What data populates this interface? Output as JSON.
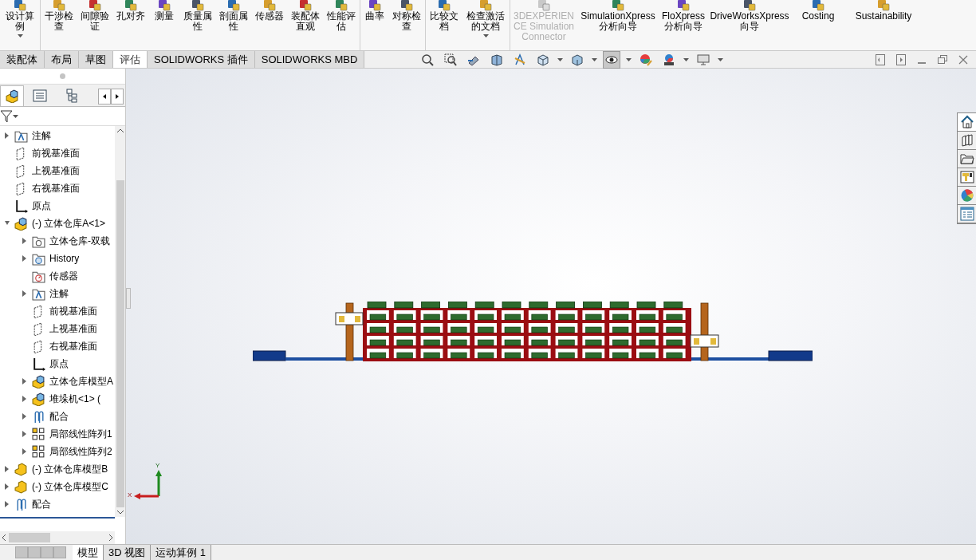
{
  "ribbon": {
    "groups": [
      {
        "items": [
          {
            "label": "设计算例",
            "dropdown": true,
            "disabled": false
          }
        ]
      },
      {
        "items": [
          {
            "label": "干涉检查",
            "dropdown": false,
            "disabled": false
          },
          {
            "label": "间隙验证",
            "dropdown": false,
            "disabled": false
          },
          {
            "label": "孔对齐",
            "dropdown": false,
            "disabled": false
          },
          {
            "label": "测量",
            "dropdown": false,
            "disabled": false
          },
          {
            "label": "质量属性",
            "dropdown": false,
            "disabled": false
          },
          {
            "label": "剖面属性",
            "dropdown": false,
            "disabled": false
          },
          {
            "label": "传感器",
            "dropdown": false,
            "disabled": false
          },
          {
            "label": "装配体直观",
            "dropdown": false,
            "disabled": false
          },
          {
            "label": "性能评估",
            "dropdown": false,
            "disabled": false
          }
        ]
      },
      {
        "items": [
          {
            "label": "曲率",
            "dropdown": false,
            "disabled": false
          },
          {
            "label": "对称检查",
            "dropdown": false,
            "disabled": false
          }
        ]
      },
      {
        "items": [
          {
            "label": "比较文档",
            "dropdown": false,
            "disabled": false
          },
          {
            "label": "检查激活的文档",
            "dropdown": true,
            "disabled": false
          }
        ]
      },
      {
        "items": [
          {
            "label": "3DEXPERIENCE Simulation Connector",
            "dropdown": false,
            "disabled": true
          },
          {
            "label": "SimulationXpress 分析向导",
            "dropdown": false,
            "disabled": false
          },
          {
            "label": "FloXpress 分析向导",
            "dropdown": false,
            "disabled": false
          },
          {
            "label": "DriveWorksXpress 向导",
            "dropdown": false,
            "disabled": false
          },
          {
            "label": "Costing",
            "dropdown": false,
            "disabled": false
          },
          {
            "label": "Sustainability",
            "dropdown": false,
            "disabled": false
          }
        ]
      }
    ]
  },
  "tabs": [
    {
      "label": "装配体",
      "selected": false
    },
    {
      "label": "布局",
      "selected": false
    },
    {
      "label": "草图",
      "selected": false
    },
    {
      "label": "评估",
      "selected": true
    },
    {
      "label": "SOLIDWORKS 插件",
      "selected": false
    },
    {
      "label": "SOLIDWORKS MBD",
      "selected": false
    }
  ],
  "view_tools": [
    {
      "selected": false
    },
    {
      "selected": false
    },
    {
      "selected": false
    },
    {
      "selected": false
    },
    {
      "selected": false
    },
    {
      "selected": false
    },
    {
      "selected": false
    },
    {
      "selected": true
    },
    {
      "selected": false
    },
    {
      "selected": false
    },
    {
      "selected": false
    }
  ],
  "tree": [
    {
      "label": "注解",
      "kind": "annotation",
      "expanded": false
    },
    {
      "label": "前视基准面",
      "kind": "plane"
    },
    {
      "label": "上视基准面",
      "kind": "plane"
    },
    {
      "label": "右视基准面",
      "kind": "plane"
    },
    {
      "label": "原点",
      "kind": "origin"
    },
    {
      "label": "(-) 立体仓库A<1>",
      "kind": "assembly",
      "expanded": true,
      "children": [
        {
          "label": "立体仓库-双载",
          "kind": "folder",
          "expanded": false
        },
        {
          "label": "History",
          "kind": "history",
          "expanded": false
        },
        {
          "label": "传感器",
          "kind": "sensor"
        },
        {
          "label": "注解",
          "kind": "annotation",
          "expanded": false
        },
        {
          "label": "前视基准面",
          "kind": "plane"
        },
        {
          "label": "上视基准面",
          "kind": "plane"
        },
        {
          "label": "右视基准面",
          "kind": "plane"
        },
        {
          "label": "原点",
          "kind": "origin"
        },
        {
          "label": "立体仓库模型A",
          "kind": "assembly",
          "expanded": false
        },
        {
          "label": "堆垛机<1> (",
          "kind": "assembly",
          "expanded": false
        },
        {
          "label": "配合",
          "kind": "mate",
          "expanded": false
        },
        {
          "label": "局部线性阵列1",
          "kind": "pattern",
          "expanded": false
        },
        {
          "label": "局部线性阵列2",
          "kind": "pattern",
          "expanded": false
        }
      ]
    },
    {
      "label": "(-) 立体仓库模型B",
      "kind": "part",
      "expanded": false
    },
    {
      "label": "(-) 立体仓库模型C",
      "kind": "part",
      "expanded": false
    },
    {
      "label": "配合",
      "kind": "mate",
      "expanded": false
    }
  ],
  "triad": {
    "y_label": "Y",
    "x_label": "X"
  },
  "bottom_tabs": [
    {
      "label": "模型",
      "selected": true
    },
    {
      "label": "3D 视图",
      "selected": false
    },
    {
      "label": "运动算例 1",
      "selected": false
    }
  ]
}
